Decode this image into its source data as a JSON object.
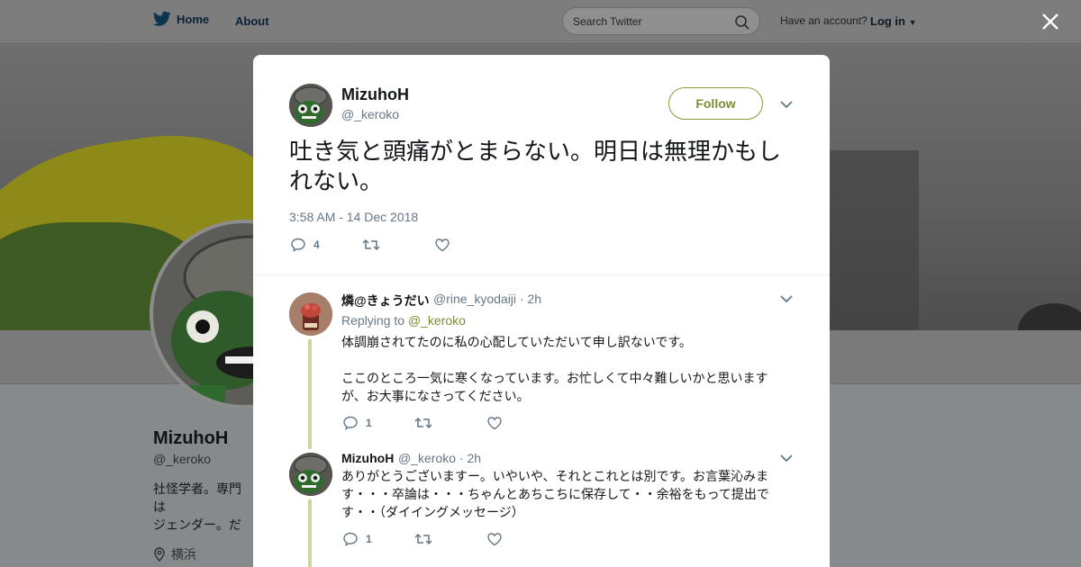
{
  "nav": {
    "home_label": "Home",
    "about_label": "About",
    "search_placeholder": "Search Twitter",
    "account_prompt": "Have an account?",
    "login_label": "Log in"
  },
  "profile": {
    "name": "MizuhoH",
    "handle": "@_keroko",
    "bio": "社怪学者。専門は\nジェンダー。だら\nす。転載禁止。",
    "location": "横浜"
  },
  "tweet": {
    "author_name": "MizuhoH",
    "author_handle": "@_keroko",
    "follow_label": "Follow",
    "text": "吐き気と頭痛がとまらない。明日は無理かもしれない。",
    "timestamp": "3:58 AM - 14 Dec 2018",
    "reply_count": "4"
  },
  "replies": [
    {
      "name": "燐@きょうだい",
      "handle": "@rine_kyodaiji",
      "time": "· 2h",
      "replying_prefix": "Replying to",
      "replying_to": "@_keroko",
      "text_1": "体調崩されてたのに私の心配していただいて申し訳ないです。",
      "text_2": "ここのところ一気に寒くなっています。お忙しくて中々難しいかと思いますが、お大事になさってください。",
      "reply_count": "1"
    },
    {
      "name": "MizuhoH",
      "handle": "@_keroko",
      "time": "· 2h",
      "text": "ありがとうございますー。いやいや、それとこれとは別です。お言葉沁みます・・・卒論は・・・ちゃんとあちこちに保存して・・余裕をもって提出です・・（ダイイングメッセージ）",
      "reply_count": "1"
    }
  ],
  "colors": {
    "accent": "#7d8c33",
    "thread_line": "#cfd59e",
    "muted": "#657786"
  }
}
